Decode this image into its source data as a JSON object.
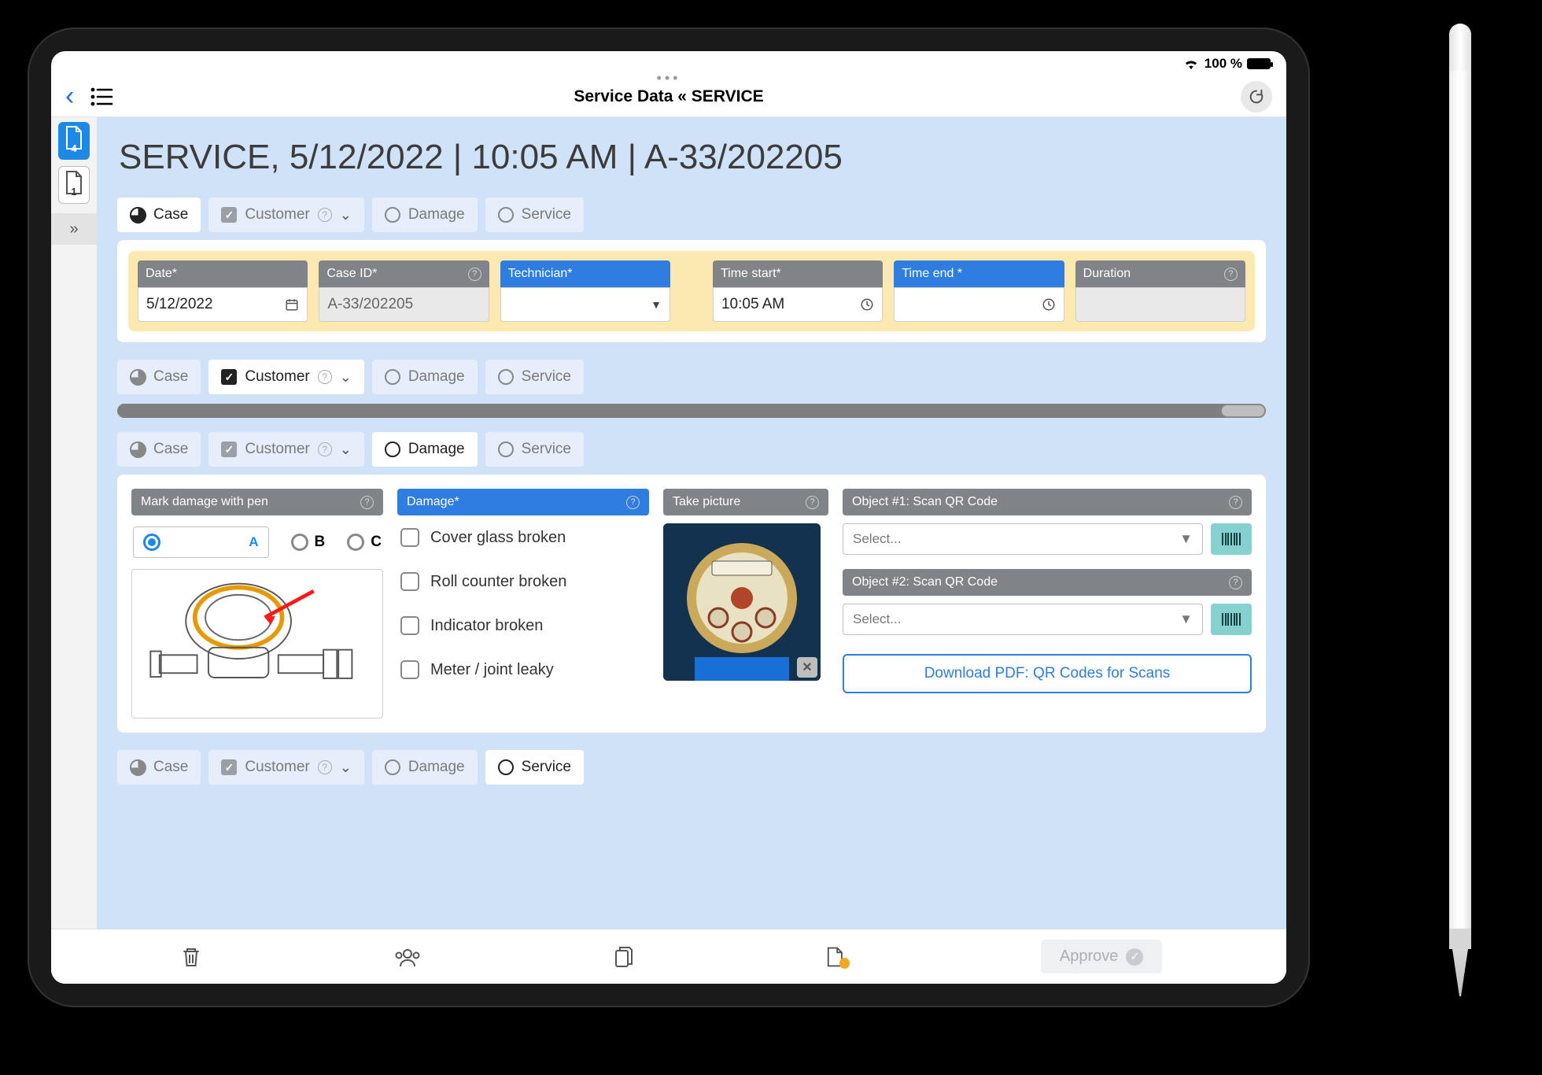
{
  "status": {
    "battery_pct": "100 %"
  },
  "nav": {
    "title": "Service Data « SERVICE"
  },
  "sidebar": {
    "badge1": "4",
    "badge2": "1"
  },
  "page": {
    "title_strong": "SERVICE,",
    "title_rest": "  5/12/2022 | 10:05 AM | A-33/202205"
  },
  "tabs": {
    "case": "Case",
    "customer": "Customer",
    "damage": "Damage",
    "service": "Service"
  },
  "fields": {
    "date": {
      "label": "Date*",
      "value": "5/12/2022"
    },
    "caseid": {
      "label": "Case ID*",
      "value": "A-33/202205"
    },
    "technician": {
      "label": "Technician*",
      "value": ""
    },
    "time_start": {
      "label": "Time start*",
      "value": "10:05 AM"
    },
    "time_end": {
      "label": "Time end *",
      "value": ""
    },
    "duration": {
      "label": "Duration",
      "value": ""
    }
  },
  "mark": {
    "label": "Mark damage with pen",
    "options": {
      "a": "A",
      "b": "B",
      "c": "C"
    }
  },
  "damage": {
    "label": "Damage*",
    "opts": {
      "cover": "Cover glass broken",
      "roll": "Roll counter broken",
      "ind": "Indicator broken",
      "leak": "Meter / joint leaky"
    }
  },
  "picture": {
    "label": "Take picture"
  },
  "scan": {
    "h1": "Object #1: Scan QR Code",
    "h2": "Object #2: Scan QR Code",
    "placeholder": "Select...",
    "download": "Download PDF: QR Codes for Scans"
  },
  "toolbar": {
    "approve": "Approve"
  }
}
